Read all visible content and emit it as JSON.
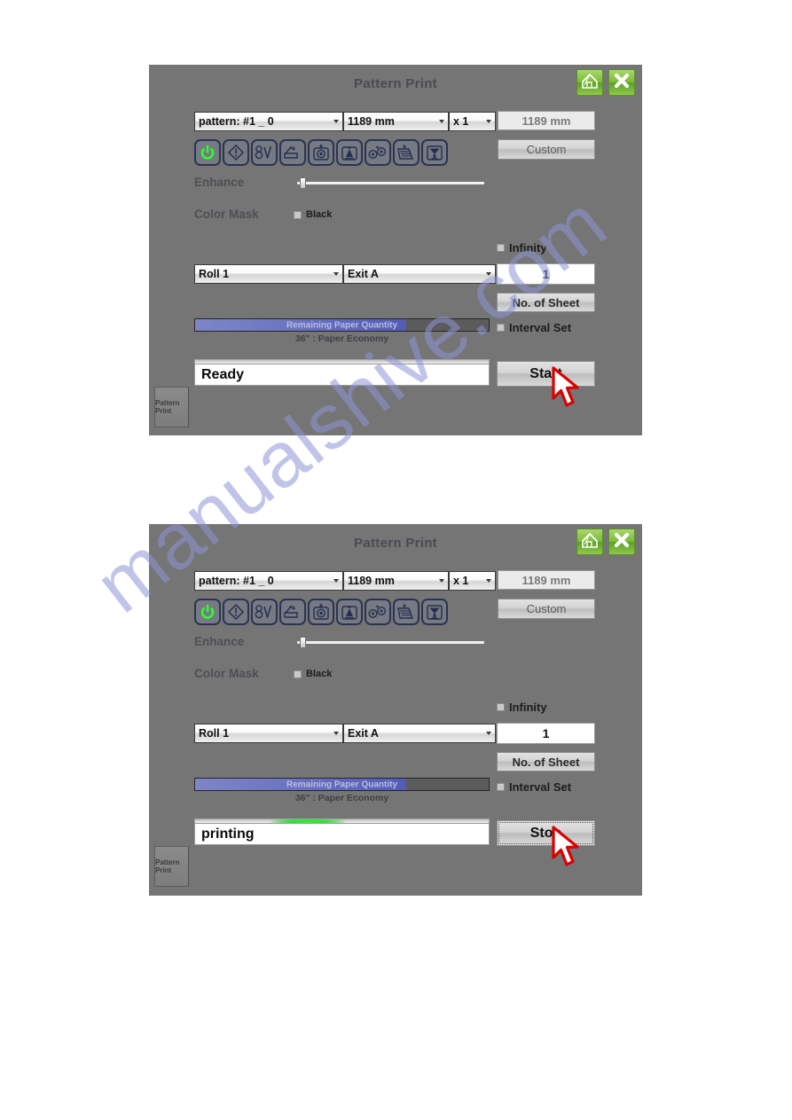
{
  "page": {
    "watermark": "manualshive.com",
    "watermark_color": "#8f94d6"
  },
  "dialogs": [
    {
      "id": "ready",
      "title": "Pattern Print",
      "home_icon": "home-icon",
      "close_icon": "close-icon",
      "pattern_select": "pattern: #1 _ 0",
      "size_select": "1189 mm",
      "copies_select": "x 1",
      "size_display": "1189 mm",
      "custom_button": "Custom",
      "enhance_label": "Enhance",
      "enhance_value": 3,
      "color_mask_label": "Color Mask",
      "black_checkbox_label": "Black",
      "black_checked": false,
      "infinity_label": "Infinity",
      "infinity_checked": false,
      "roll_select": "Roll 1",
      "exit_select": "Exit A",
      "sheet_count": "1",
      "no_of_sheet_button": "No. of Sheet",
      "interval_set_label": "Interval Set",
      "interval_checked": false,
      "paper_bar_label": "Remaining Paper Quantity",
      "paper_bar_fill_percent": 72,
      "paper_caption": "36\" : Paper Economy",
      "status_message": "Ready",
      "progress_percent": 0,
      "action_button": "Start",
      "action_focused": false,
      "side_tab_label": "Pattern Print"
    },
    {
      "id": "printing",
      "title": "Pattern Print",
      "home_icon": "home-icon",
      "close_icon": "close-icon",
      "pattern_select": "pattern: #1 _ 0",
      "size_select": "1189 mm",
      "copies_select": "x 1",
      "size_display": "1189 mm",
      "custom_button": "Custom",
      "enhance_label": "Enhance",
      "enhance_value": 3,
      "color_mask_label": "Color Mask",
      "black_checkbox_label": "Black",
      "black_checked": false,
      "infinity_label": "Infinity",
      "infinity_checked": false,
      "roll_select": "Roll 1",
      "exit_select": "Exit A",
      "sheet_count": "1",
      "no_of_sheet_button": "No. of Sheet",
      "interval_set_label": "Interval Set",
      "interval_checked": false,
      "paper_bar_label": "Remaining Paper Quantity",
      "paper_bar_fill_percent": 72,
      "paper_caption": "36\" : Paper Economy",
      "status_message": "printing",
      "progress_percent": 38,
      "action_button": "Stop",
      "action_focused": true,
      "side_tab_label": "Pattern Print"
    }
  ],
  "status_icons": [
    {
      "name": "power-ready-icon",
      "active": true
    },
    {
      "name": "warning-icon",
      "active": false
    },
    {
      "name": "ink-level-icon",
      "active": false
    },
    {
      "name": "media-load-icon",
      "active": false
    },
    {
      "name": "roll-media-icon",
      "active": false
    },
    {
      "name": "ink-tank-icon",
      "active": false
    },
    {
      "name": "roller-icon",
      "active": false
    },
    {
      "name": "stacker-icon",
      "active": false
    },
    {
      "name": "printhead-icon",
      "active": false
    }
  ]
}
